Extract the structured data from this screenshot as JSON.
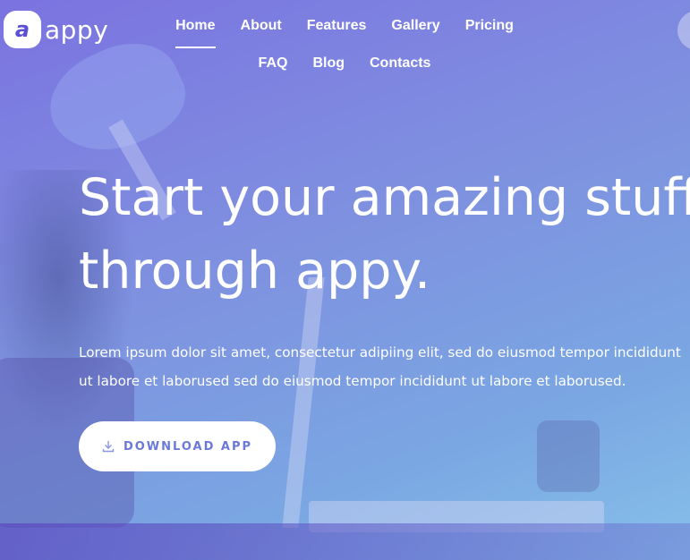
{
  "brand": {
    "badge_letter": "a",
    "name": "appy"
  },
  "nav": {
    "items": [
      "Home",
      "About",
      "Features",
      "Gallery",
      "Pricing",
      "FAQ",
      "Blog",
      "Contacts"
    ],
    "active": "Home"
  },
  "hero": {
    "title_line1": "Start your amazing stuff",
    "title_line2": "through appy.",
    "body": "Lorem ipsum dolor sit amet, consectetur adipiing elit, sed do eiusmod tempor incididunt ut labore et laborused sed do eiusmod tempor incididunt ut labore et laborused.",
    "button_label": "DOWNLOAD APP",
    "button_icon": "download-icon"
  },
  "colors": {
    "accent": "#6a78d8",
    "brand_purple": "#5b4fd3"
  }
}
